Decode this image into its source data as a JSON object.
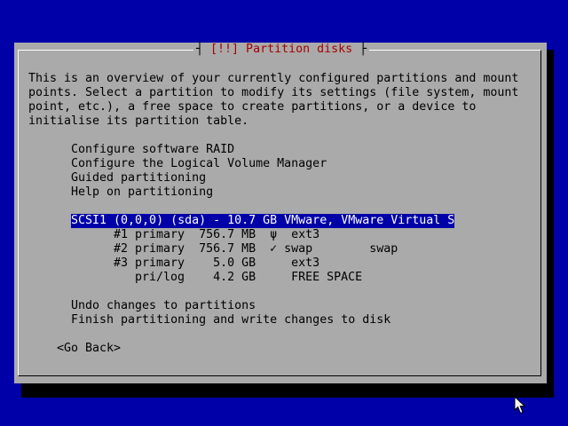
{
  "dialog": {
    "title": "[!!] Partition disks",
    "description": [
      "This is an overview of your currently configured partitions and mount",
      "points. Select a partition to modify its settings (file system, mount",
      "point, etc.), a free space to create partitions, or a device to",
      "initialise its partition table."
    ],
    "menu_items": [
      "Configure software RAID",
      "Configure the Logical Volume Manager",
      "Guided partitioning",
      "Help on partitioning"
    ],
    "disk": {
      "label": "SCSI1 (0,0,0) (sda) - 10.7 GB VMware, VMware Virtual S",
      "partitions": [
        {
          "text": "#1 primary  756.7 MB  ψ  ext3"
        },
        {
          "text": "#2 primary  756.7 MB  ✓ swap        swap"
        },
        {
          "text": "#3 primary    5.0 GB     ext3"
        },
        {
          "text": "   pri/log    4.2 GB     FREE SPACE"
        }
      ]
    },
    "actions": [
      "Undo changes to partitions",
      "Finish partitioning and write changes to disk"
    ],
    "go_back_label": "<Go Back>"
  },
  "colors": {
    "background": "#0000a8",
    "dialog": "#aaaaaa",
    "title": "#a80000",
    "selection_bg": "#0000a8",
    "selection_fg": "#ffffff"
  }
}
